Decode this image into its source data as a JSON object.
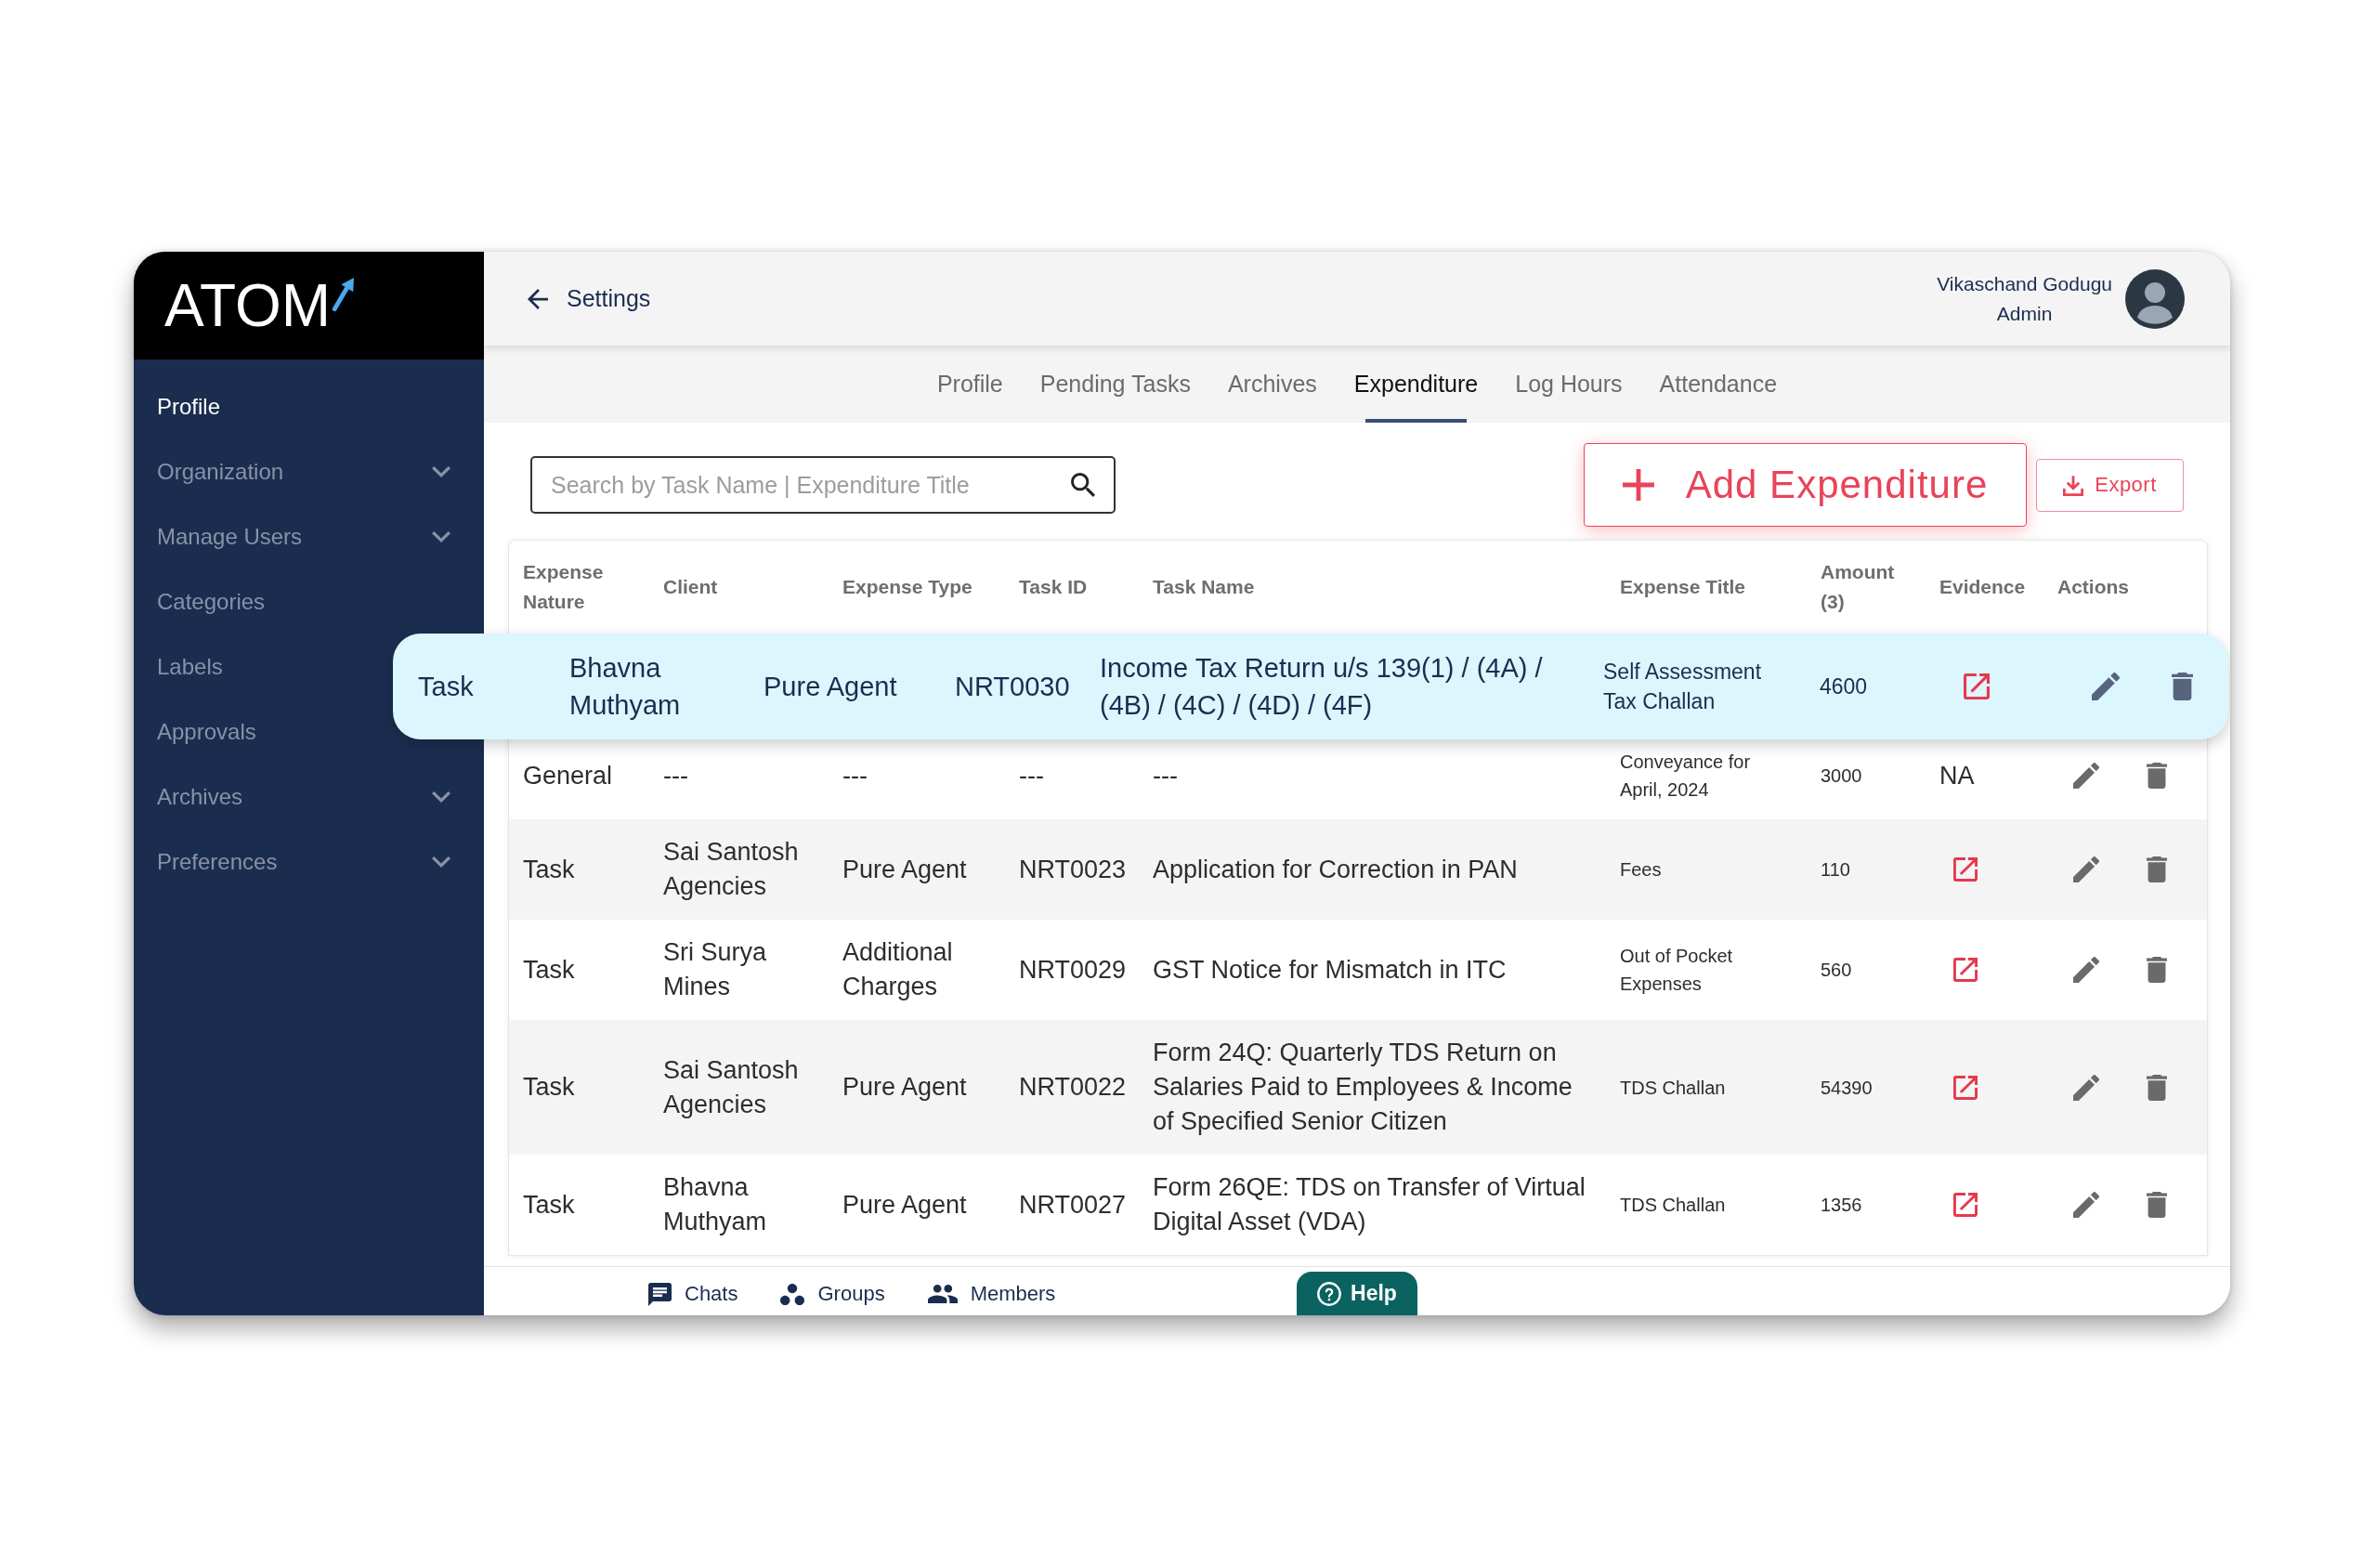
{
  "sidebar": {
    "logo": "ATOM",
    "items": [
      {
        "label": "Profile",
        "kind": "link",
        "selected": true
      },
      {
        "label": "Organization",
        "kind": "group",
        "selected": false
      },
      {
        "label": "Manage Users",
        "kind": "group",
        "selected": false
      },
      {
        "label": "Categories",
        "kind": "link",
        "selected": false
      },
      {
        "label": "Labels",
        "kind": "link",
        "selected": false
      },
      {
        "label": "Approvals",
        "kind": "link",
        "selected": false
      },
      {
        "label": "Archives",
        "kind": "group",
        "selected": false
      },
      {
        "label": "Preferences",
        "kind": "group",
        "selected": false
      }
    ]
  },
  "header": {
    "back_label": "Settings",
    "user_name": "Vikaschand Godugu",
    "user_role": "Admin"
  },
  "tabs": [
    {
      "label": "Profile",
      "selected": false
    },
    {
      "label": "Pending Tasks",
      "selected": false
    },
    {
      "label": "Archives",
      "selected": false
    },
    {
      "label": "Expenditure",
      "selected": true
    },
    {
      "label": "Log Hours",
      "selected": false
    },
    {
      "label": "Attendance",
      "selected": false
    }
  ],
  "toolbar": {
    "search": {
      "placeholder": "Search by Task Name | Expenditure Title"
    },
    "add_button": "Add Expenditure",
    "export_button": "Export"
  },
  "table": {
    "columns": [
      "Expense Nature",
      "Client",
      "Expense Type",
      "Task ID",
      "Task Name",
      "Expense Title",
      "Amount (3)",
      "Evidence",
      "Actions"
    ],
    "rows": [
      {
        "highlighted": true,
        "expense_nature": "Task",
        "client": "Bhavna Muthyam",
        "expense_type": "Pure Agent",
        "task_id": "NRT0030",
        "task_name": "Income Tax Return u/s 139(1) / (4A) / (4B) / (4C) / (4D) / (4F)",
        "expense_title": "Self Assessment Tax Challan",
        "amount": "4600",
        "evidence": {
          "kind": "link"
        }
      },
      {
        "highlighted": false,
        "expense_nature": "General",
        "client": "---",
        "expense_type": "---",
        "task_id": "---",
        "task_name": "---",
        "expense_title": "Conveyance for April, 2024",
        "amount": "3000",
        "evidence": {
          "kind": "text",
          "label": "NA"
        }
      },
      {
        "highlighted": false,
        "expense_nature": "Task",
        "client": "Sai Santosh Agencies",
        "expense_type": "Pure Agent",
        "task_id": "NRT0023",
        "task_name": "Application for Correction in PAN",
        "expense_title": "Fees",
        "amount": "110",
        "evidence": {
          "kind": "link"
        }
      },
      {
        "highlighted": false,
        "expense_nature": "Task",
        "client": "Sri Surya Mines",
        "expense_type": "Additional Charges",
        "task_id": "NRT0029",
        "task_name": "GST Notice for Mismatch in ITC",
        "expense_title": "Out of Pocket Expenses",
        "amount": "560",
        "evidence": {
          "kind": "link"
        }
      },
      {
        "highlighted": false,
        "expense_nature": "Task",
        "client": "Sai Santosh Agencies",
        "expense_type": "Pure Agent",
        "task_id": "NRT0022",
        "task_name": "Form 24Q: Quarterly TDS Return on Salaries Paid to Employees & Income of Specified Senior Citizen",
        "expense_title": "TDS Challan",
        "amount": "54390",
        "evidence": {
          "kind": "link"
        }
      },
      {
        "highlighted": false,
        "expense_nature": "Task",
        "client": "Bhavna Muthyam",
        "expense_type": "Pure Agent",
        "task_id": "NRT0027",
        "task_name": "Form 26QE: TDS on Transfer of Virtual Digital Asset (VDA)",
        "expense_title": "TDS Challan",
        "amount": "1356",
        "evidence": {
          "kind": "link"
        }
      }
    ]
  },
  "bottom_bar": {
    "items": [
      {
        "label": "Chats",
        "kind": "chats"
      },
      {
        "label": "Groups",
        "kind": "groups"
      },
      {
        "label": "Members",
        "kind": "members"
      }
    ],
    "help_button": "Help"
  }
}
